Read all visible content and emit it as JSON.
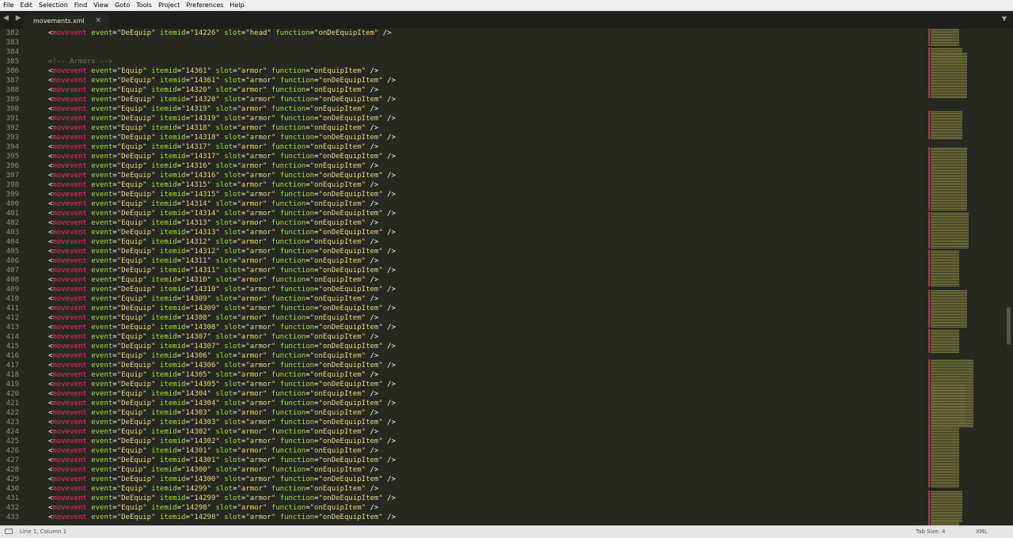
{
  "menu": [
    "File",
    "Edit",
    "Selection",
    "Find",
    "View",
    "Goto",
    "Tools",
    "Project",
    "Preferences",
    "Help"
  ],
  "tab": {
    "title": "movements.xml",
    "close": "×"
  },
  "nav_arrows": "◀ ▶",
  "tab_dropdown": "▼",
  "lines": [
    {
      "n": "382",
      "t": "mv",
      "ev": "DeEquip",
      "id": "14226",
      "slot": "head",
      "fn": "onDeEquipItem"
    },
    {
      "n": "383",
      "t": "blank"
    },
    {
      "n": "384",
      "t": "blank"
    },
    {
      "n": "385",
      "t": "comment",
      "text": "<!-- Armors -->"
    },
    {
      "n": "386",
      "t": "mv",
      "ev": "Equip",
      "id": "14361",
      "slot": "armor",
      "fn": "onEquipItem"
    },
    {
      "n": "387",
      "t": "mv",
      "ev": "DeEquip",
      "id": "14361",
      "slot": "armor",
      "fn": "onDeEquipItem"
    },
    {
      "n": "388",
      "t": "mv",
      "ev": "Equip",
      "id": "14320",
      "slot": "armor",
      "fn": "onEquipItem"
    },
    {
      "n": "389",
      "t": "mv",
      "ev": "DeEquip",
      "id": "14320",
      "slot": "armor",
      "fn": "onDeEquipItem"
    },
    {
      "n": "390",
      "t": "mv",
      "ev": "Equip",
      "id": "14319",
      "slot": "armor",
      "fn": "onEquipItem"
    },
    {
      "n": "391",
      "t": "mv",
      "ev": "DeEquip",
      "id": "14319",
      "slot": "armor",
      "fn": "onDeEquipItem"
    },
    {
      "n": "392",
      "t": "mv",
      "ev": "Equip",
      "id": "14318",
      "slot": "armor",
      "fn": "onEquipItem"
    },
    {
      "n": "393",
      "t": "mv",
      "ev": "DeEquip",
      "id": "14318",
      "slot": "armor",
      "fn": "onDeEquipItem"
    },
    {
      "n": "394",
      "t": "mv",
      "ev": "Equip",
      "id": "14317",
      "slot": "armor",
      "fn": "onEquipItem"
    },
    {
      "n": "395",
      "t": "mv",
      "ev": "DeEquip",
      "id": "14317",
      "slot": "armor",
      "fn": "onDeEquipItem"
    },
    {
      "n": "396",
      "t": "mv",
      "ev": "Equip",
      "id": "14316",
      "slot": "armor",
      "fn": "onEquipItem"
    },
    {
      "n": "397",
      "t": "mv",
      "ev": "DeEquip",
      "id": "14316",
      "slot": "armor",
      "fn": "onDeEquipItem"
    },
    {
      "n": "398",
      "t": "mv",
      "ev": "Equip",
      "id": "14315",
      "slot": "armor",
      "fn": "onEquipItem"
    },
    {
      "n": "399",
      "t": "mv",
      "ev": "DeEquip",
      "id": "14315",
      "slot": "armor",
      "fn": "onDeEquipItem"
    },
    {
      "n": "400",
      "t": "mv",
      "ev": "Equip",
      "id": "14314",
      "slot": "armor",
      "fn": "onEquipItem"
    },
    {
      "n": "401",
      "t": "mv",
      "ev": "DeEquip",
      "id": "14314",
      "slot": "armor",
      "fn": "onDeEquipItem"
    },
    {
      "n": "402",
      "t": "mv",
      "ev": "Equip",
      "id": "14313",
      "slot": "armor",
      "fn": "onEquipItem"
    },
    {
      "n": "403",
      "t": "mv",
      "ev": "DeEquip",
      "id": "14313",
      "slot": "armor",
      "fn": "onDeEquipItem"
    },
    {
      "n": "404",
      "t": "mv",
      "ev": "Equip",
      "id": "14312",
      "slot": "armor",
      "fn": "onEquipItem"
    },
    {
      "n": "405",
      "t": "mv",
      "ev": "DeEquip",
      "id": "14312",
      "slot": "armor",
      "fn": "onDeEquipItem"
    },
    {
      "n": "406",
      "t": "mv",
      "ev": "Equip",
      "id": "14311",
      "slot": "armor",
      "fn": "onEquipItem"
    },
    {
      "n": "407",
      "t": "mv",
      "ev": "DeEquip",
      "id": "14311",
      "slot": "armor",
      "fn": "onDeEquipItem"
    },
    {
      "n": "408",
      "t": "mv",
      "ev": "Equip",
      "id": "14310",
      "slot": "armor",
      "fn": "onEquipItem"
    },
    {
      "n": "409",
      "t": "mv",
      "ev": "DeEquip",
      "id": "14310",
      "slot": "armor",
      "fn": "onDeEquipItem"
    },
    {
      "n": "410",
      "t": "mv",
      "ev": "Equip",
      "id": "14309",
      "slot": "armor",
      "fn": "onEquipItem"
    },
    {
      "n": "411",
      "t": "mv",
      "ev": "DeEquip",
      "id": "14309",
      "slot": "armor",
      "fn": "onDeEquipItem"
    },
    {
      "n": "412",
      "t": "mv",
      "ev": "Equip",
      "id": "14308",
      "slot": "armor",
      "fn": "onEquipItem"
    },
    {
      "n": "413",
      "t": "mv",
      "ev": "DeEquip",
      "id": "14308",
      "slot": "armor",
      "fn": "onDeEquipItem"
    },
    {
      "n": "414",
      "t": "mv",
      "ev": "Equip",
      "id": "14307",
      "slot": "armor",
      "fn": "onEquipItem"
    },
    {
      "n": "415",
      "t": "mv",
      "ev": "DeEquip",
      "id": "14307",
      "slot": "armor",
      "fn": "onDeEquipItem"
    },
    {
      "n": "416",
      "t": "mv",
      "ev": "Equip",
      "id": "14306",
      "slot": "armor",
      "fn": "onEquipItem"
    },
    {
      "n": "417",
      "t": "mv",
      "ev": "DeEquip",
      "id": "14306",
      "slot": "armor",
      "fn": "onDeEquipItem"
    },
    {
      "n": "418",
      "t": "mv",
      "ev": "Equip",
      "id": "14305",
      "slot": "armor",
      "fn": "onEquipItem"
    },
    {
      "n": "419",
      "t": "mv",
      "ev": "DeEquip",
      "id": "14305",
      "slot": "armor",
      "fn": "onDeEquipItem"
    },
    {
      "n": "420",
      "t": "mv",
      "ev": "Equip",
      "id": "14304",
      "slot": "armor",
      "fn": "onEquipItem"
    },
    {
      "n": "421",
      "t": "mv",
      "ev": "DeEquip",
      "id": "14304",
      "slot": "armor",
      "fn": "onDeEquipItem"
    },
    {
      "n": "422",
      "t": "mv",
      "ev": "Equip",
      "id": "14303",
      "slot": "armor",
      "fn": "onEquipItem"
    },
    {
      "n": "423",
      "t": "mv",
      "ev": "DeEquip",
      "id": "14303",
      "slot": "armor",
      "fn": "onDeEquipItem"
    },
    {
      "n": "424",
      "t": "mv",
      "ev": "Equip",
      "id": "14302",
      "slot": "armor",
      "fn": "onEquipItem"
    },
    {
      "n": "425",
      "t": "mv",
      "ev": "DeEquip",
      "id": "14302",
      "slot": "armor",
      "fn": "onDeEquipItem"
    },
    {
      "n": "426",
      "t": "mv",
      "ev": "Equip",
      "id": "14301",
      "slot": "armor",
      "fn": "onEquipItem"
    },
    {
      "n": "427",
      "t": "mv",
      "ev": "DeEquip",
      "id": "14301",
      "slot": "armor",
      "fn": "onDeEquipItem"
    },
    {
      "n": "428",
      "t": "mv",
      "ev": "Equip",
      "id": "14300",
      "slot": "armor",
      "fn": "onEquipItem"
    },
    {
      "n": "429",
      "t": "mv",
      "ev": "DeEquip",
      "id": "14300",
      "slot": "armor",
      "fn": "onDeEquipItem"
    },
    {
      "n": "430",
      "t": "mv",
      "ev": "Equip",
      "id": "14299",
      "slot": "armor",
      "fn": "onEquipItem"
    },
    {
      "n": "431",
      "t": "mv",
      "ev": "DeEquip",
      "id": "14299",
      "slot": "armor",
      "fn": "onDeEquipItem"
    },
    {
      "n": "432",
      "t": "mv",
      "ev": "Equip",
      "id": "14298",
      "slot": "armor",
      "fn": "onEquipItem"
    },
    {
      "n": "433",
      "t": "mv",
      "ev": "DeEquip",
      "id": "14298",
      "slot": "armor",
      "fn": "onDeEquipItem"
    }
  ],
  "status": {
    "position": "Line 1, Column 1",
    "tab_size": "Tab Size: 4",
    "syntax": "XML"
  },
  "colors": {
    "background": "#272822",
    "tag": "#f92672",
    "attr": "#a6e22e",
    "string": "#e6db74",
    "comment": "#75715e",
    "line_number": "#8f908a"
  }
}
